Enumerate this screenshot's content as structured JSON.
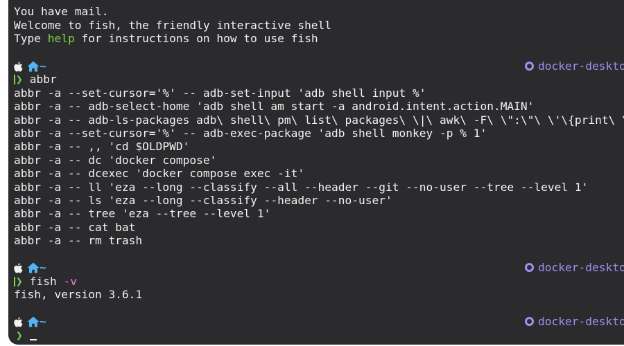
{
  "motd": {
    "line1": "You have mail.",
    "line2": "Welcome to fish, the friendly interactive shell",
    "line3_before": "Type ",
    "line3_help": "help",
    "line3_after": " for instructions on how to use fish"
  },
  "prompt": {
    "dir": "~",
    "context": "docker-desktop",
    "arrow": "❯"
  },
  "block1": {
    "command": "abbr",
    "output": [
      "abbr -a --set-cursor='%' -- adb-set-input 'adb shell input %'",
      "abbr -a -- adb-select-home 'adb shell am start -a android.intent.action.MAIN'",
      "abbr -a -- adb-ls-packages adb\\ shell\\ pm\\ list\\ packages\\ \\|\\ awk\\ -F\\ \\\":\\\"\\ \\'\\{print\\ \\",
      "abbr -a --set-cursor='%' -- adb-exec-package 'adb shell monkey -p % 1'",
      "abbr -a -- ,, 'cd $OLDPWD'",
      "abbr -a -- dc 'docker compose'",
      "abbr -a -- dcexec 'docker compose exec -it'",
      "abbr -a -- ll 'eza --long --classify --all --header --git --no-user --tree --level 1'",
      "abbr -a -- ls 'eza --long --classify --header --no-user'",
      "abbr -a -- tree 'eza --tree --level 1'",
      "abbr -a -- cat bat",
      "abbr -a -- rm trash"
    ]
  },
  "block2": {
    "command": "fish",
    "flag": "-v",
    "output": "fish, version 3.6.1"
  },
  "colors": {
    "background": "#2b2b2e",
    "prompt_green": "#7fd34e",
    "dir_blue": "#53b3f0",
    "context_purple": "#a48ef2",
    "flag_pink": "#e87fd9"
  }
}
